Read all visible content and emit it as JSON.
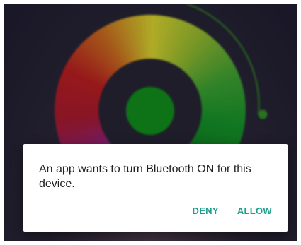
{
  "dialog": {
    "message": "An app wants to turn Bluetooth ON for this device.",
    "deny_label": "DENY",
    "allow_label": "ALLOW"
  },
  "colors": {
    "accent": "#1e9f8c",
    "background": "#1e1c2b",
    "dialog_text": "#212121",
    "dialog_background": "#ffffff",
    "center_dot": "#0f8a16"
  },
  "wheel_colors": [
    "#d4cf2a",
    "#8fb52a",
    "#3c9e2e",
    "#138f24",
    "#0d7a1c",
    "#2b3aa0",
    "#5a1e96",
    "#8a1f7c",
    "#a4182a",
    "#b51c1c",
    "#c76a1c",
    "#d4cf2a"
  ]
}
